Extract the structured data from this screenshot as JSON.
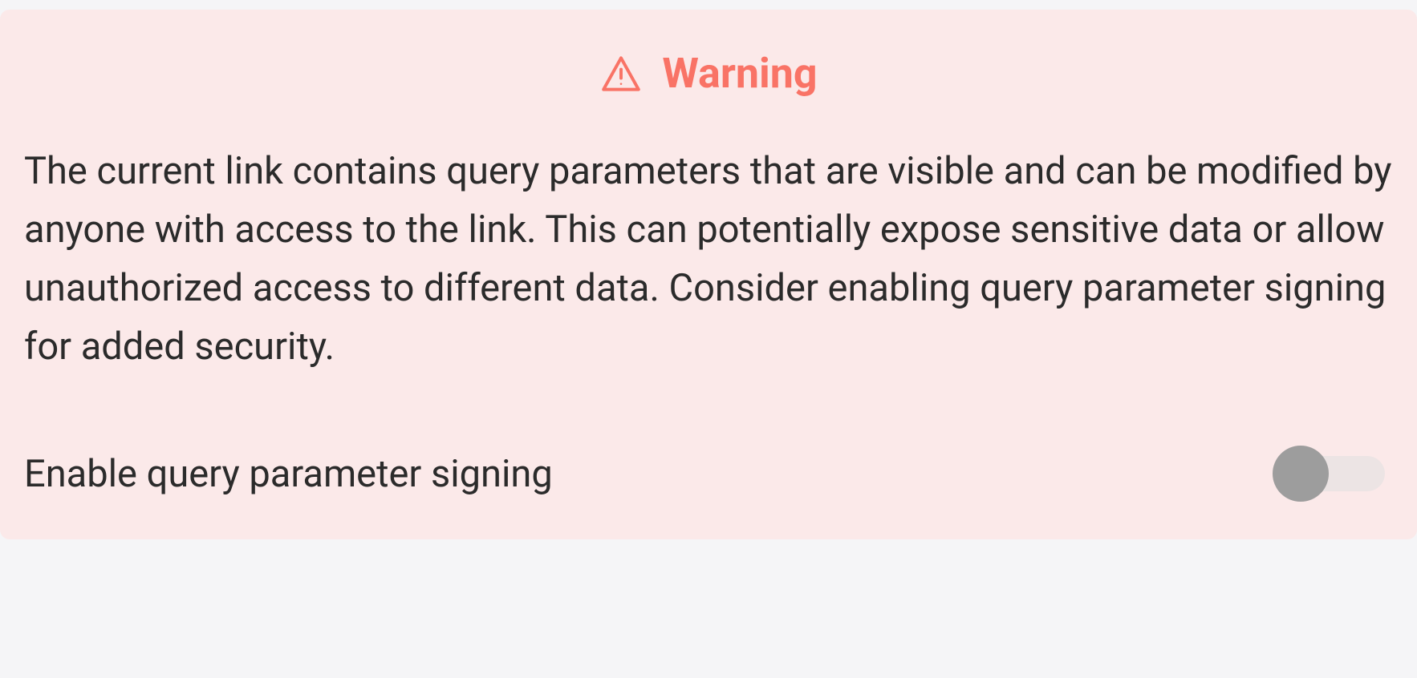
{
  "warning": {
    "title": "Warning",
    "body": "The current link contains query parameters that are visible and can be modified by anyone with access to the link. This can potentially expose sensitive data or allow unauthorized access to different data. Consider enabling query parameter signing for added security.",
    "toggle_label": "Enable query parameter signing",
    "toggle_state": false,
    "accent_color": "#f97366",
    "bg_color": "#fbe9e9"
  }
}
